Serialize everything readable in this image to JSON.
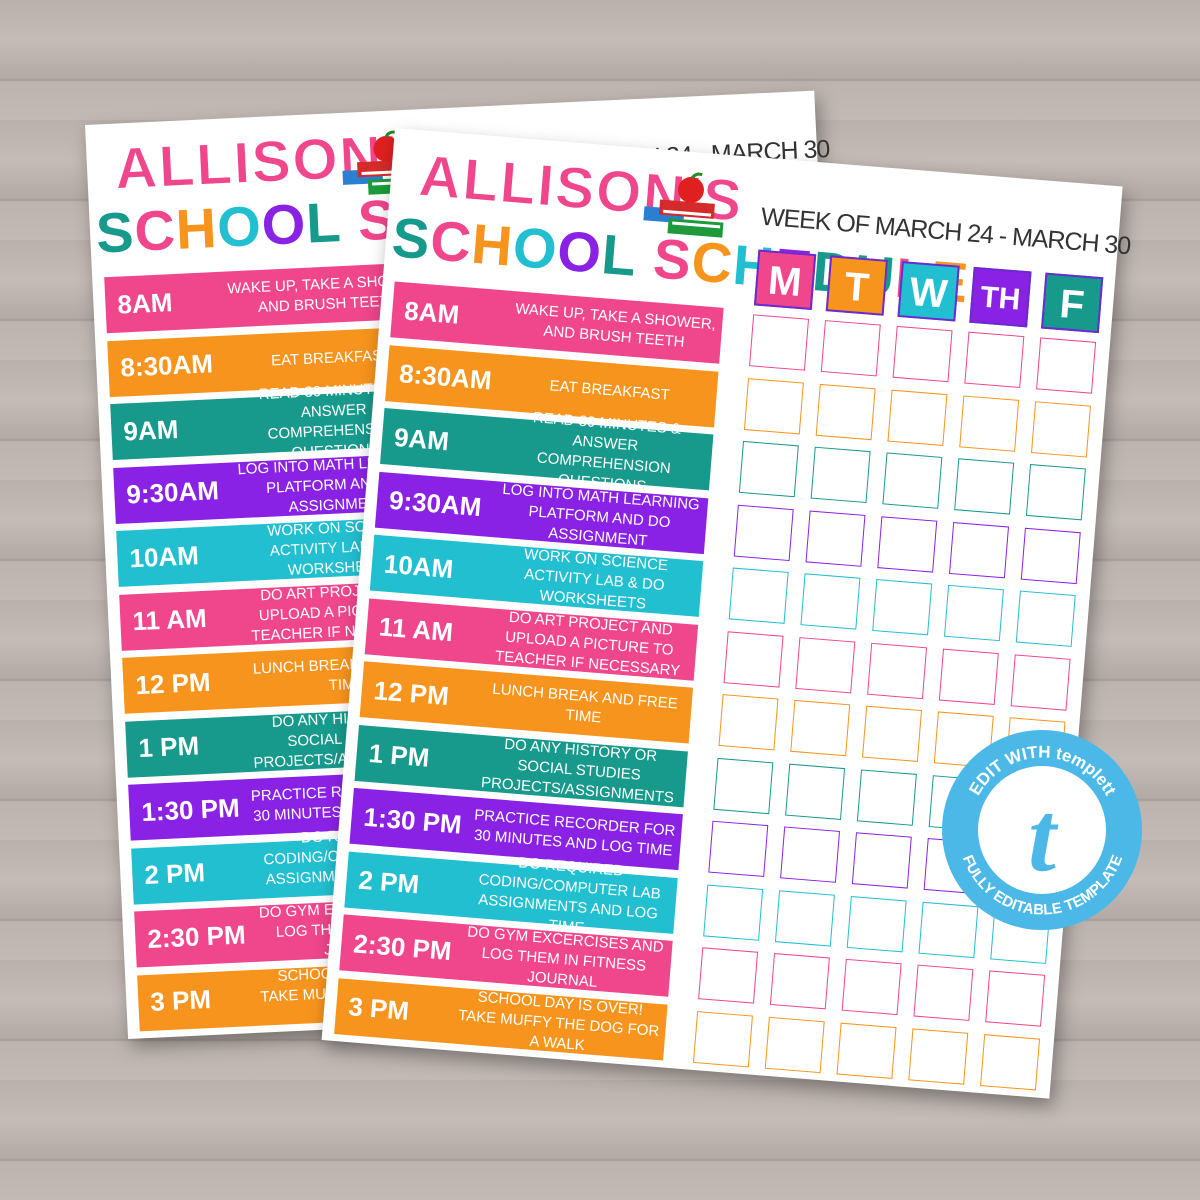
{
  "title_line1": "ALLISON'S",
  "title_line2": "SCHOOL SCHEDULE",
  "week": "WEEK OF MARCH 24 - MARCH 30",
  "days": [
    {
      "label": "M",
      "color": "#f0468c"
    },
    {
      "label": "T",
      "color": "#f7941d"
    },
    {
      "label": "W",
      "color": "#22bfd0"
    },
    {
      "label": "TH",
      "color": "#8a22e6"
    },
    {
      "label": "F",
      "color": "#17998c"
    }
  ],
  "title_letter_colors": [
    "#17998c",
    "#f0468c",
    "#f7941d",
    "#22bfd0",
    "#8a22e6",
    "#17998c"
  ],
  "schedule": [
    {
      "time": "8AM",
      "task": "Wake up, take a shower, and brush teeth",
      "color": "#f0468c"
    },
    {
      "time": "8:30AM",
      "task": "Eat breakfast",
      "color": "#f7941d"
    },
    {
      "time": "9AM",
      "task": "Read 30 minutes & answer comprehension questions",
      "color": "#17998c"
    },
    {
      "time": "9:30AM",
      "task": "Log into math learning platform and do assignment",
      "color": "#8a22e6"
    },
    {
      "time": "10AM",
      "task": "Work on science activity lab & do worksheets",
      "color": "#22bfd0"
    },
    {
      "time": "11 AM",
      "task": "Do art project and upload a picture to teacher if necessary",
      "color": "#f0468c"
    },
    {
      "time": "12 PM",
      "task": "Lunch break and free time",
      "color": "#f7941d"
    },
    {
      "time": "1 PM",
      "task": "Do any history or social studies projects/assignments",
      "color": "#17998c"
    },
    {
      "time": "1:30 PM",
      "task": "Practice recorder for 30 minutes and log time",
      "color": "#8a22e6"
    },
    {
      "time": "2 PM",
      "task": "Do required coding/computer lab assignments and log time",
      "color": "#22bfd0"
    },
    {
      "time": "2:30 PM",
      "task": "Do gym excercises and log them in fitness journal",
      "color": "#f0468c"
    },
    {
      "time": "3 PM",
      "task": "School day is over! Take Muffy the dog for a walk",
      "color": "#f7941d"
    }
  ],
  "badge": {
    "top_text": "EDIT WITH templett",
    "bottom_text": "FULLY EDITABLE TEMPLATE",
    "logo_letter": "t",
    "color": "#4bb8e8"
  }
}
